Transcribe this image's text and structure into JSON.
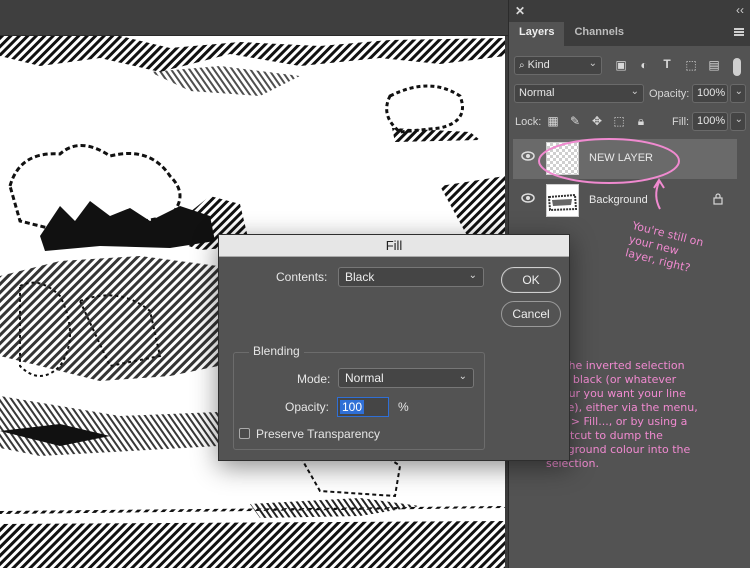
{
  "layers_panel": {
    "tabs": [
      "Layers",
      "Channels"
    ],
    "kind_filter": "Kind",
    "blend_mode": "Normal",
    "opacity_label": "Opacity:",
    "opacity_value": "100%",
    "lock_label": "Lock:",
    "fill_label": "Fill:",
    "fill_value": "100%",
    "layers": [
      {
        "name": "NEW LAYER",
        "selected": true
      },
      {
        "name": "Background",
        "selected": false
      }
    ]
  },
  "fill_dialog": {
    "title": "Fill",
    "contents_label": "Contents:",
    "contents_value": "Black",
    "ok_label": "OK",
    "cancel_label": "Cancel",
    "blending_label": "Blending",
    "mode_label": "Mode:",
    "mode_value": "Normal",
    "opacity_label": "Opacity:",
    "opacity_value": "100",
    "opacity_unit": "%",
    "preserve_label": "Preserve Transparency"
  },
  "annotations": {
    "layer_note": [
      "You're still on",
      "your new",
      "layer, right?"
    ],
    "fill_note": [
      "Fill the inverted selection",
      "with black (or whatever",
      "colour you want your line",
      "to be), either via the menu,",
      "Edit > Fill..., or by using a",
      "shortcut to dump the",
      "foreground colour into the",
      "selection."
    ]
  },
  "colors": {
    "annotation": "#f08ad0",
    "selection_highlight": "#2f6fd6"
  }
}
